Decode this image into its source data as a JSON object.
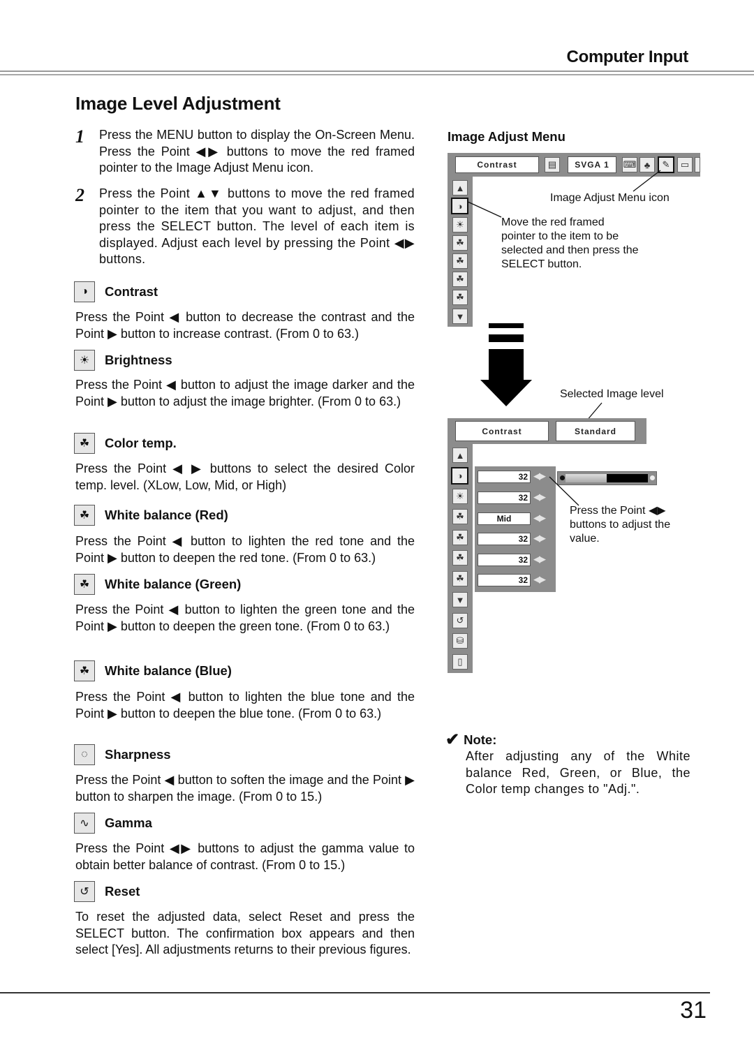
{
  "header": {
    "section_title": "Computer Input",
    "page_title": "Image Level Adjustment"
  },
  "steps": [
    {
      "number": "1",
      "text": "Press the MENU button to display the On-Screen Menu.  Press the Point ◀▶ buttons to move the red framed pointer to the Image Adjust Menu icon."
    },
    {
      "number": "2",
      "text": "Press the Point ▲▼ buttons to move the red framed pointer to the item that you want to adjust, and then press the SELECT button.  The level of each item is displayed.  Adjust each level by pressing the Point ◀▶ buttons."
    }
  ],
  "items": [
    {
      "icon": "contrast-icon",
      "glyph": "◑",
      "label": "Contrast",
      "desc": "Press the Point ◀ button to decrease the contrast and the Point ▶ button to increase contrast. (From 0 to 63.)"
    },
    {
      "icon": "brightness-icon",
      "glyph": "☀",
      "label": "Brightness",
      "desc": "Press the Point ◀ button to adjust the image darker and the Point ▶ button to adjust the image brighter. (From 0 to 63.)"
    },
    {
      "icon": "color-temp-icon",
      "glyph": "☘",
      "label": "Color temp.",
      "desc": "Press the Point ◀ ▶ buttons to select the desired Color temp. level. (XLow, Low, Mid, or High)"
    },
    {
      "icon": "white-balance-red-icon",
      "glyph": "☘",
      "label": "White balance (Red)",
      "desc": "Press the Point ◀ button to lighten the red tone and the Point ▶ button to deepen the red tone. (From 0 to 63.)"
    },
    {
      "icon": "white-balance-green-icon",
      "glyph": "☘",
      "label": "White balance (Green)",
      "desc": "Press the Point ◀ button to lighten the green tone and the Point ▶ button to deepen the green tone. (From 0 to 63.)"
    },
    {
      "icon": "white-balance-blue-icon",
      "glyph": "☘",
      "label": "White balance (Blue)",
      "desc": "Press the Point ◀ button to lighten the blue tone and the Point ▶ button to deepen the blue tone. (From 0 to 63.)"
    },
    {
      "icon": "sharpness-icon",
      "glyph": "◌",
      "label": "Sharpness",
      "desc": "Press the Point ◀ button to soften the image and the Point ▶ button to sharpen the image. (From 0 to 15.)"
    },
    {
      "icon": "gamma-icon",
      "glyph": "∿",
      "label": "Gamma",
      "desc": "Press the Point ◀▶ buttons to adjust the gamma value to obtain better balance of contrast. (From 0 to 15.)"
    },
    {
      "icon": "reset-icon",
      "glyph": "↺",
      "label": "Reset",
      "desc": "To reset the adjusted data, select Reset and press the SELECT button.  The confirmation box appears and then select [Yes].  All adjustments returns to their previous figures."
    }
  ],
  "image_adjust_menu": {
    "heading": "Image Adjust Menu",
    "top_menu": {
      "item_label": "Contrast",
      "source_label": "SVGA 1"
    },
    "callout_icon": "Image Adjust Menu icon",
    "callout_pointer": "Move the red framed pointer to the item to be selected and then press the SELECT button."
  },
  "selected_menu": {
    "callout_level": "Selected Image level",
    "item_label": "Contrast",
    "level_label": "Standard",
    "values": [
      "32",
      "32",
      "Mid",
      "32",
      "32",
      "32"
    ],
    "arrows": "◀▶",
    "contrast_slider_fraction": 0.5,
    "callout_adjust": "Press the Point ◀▶ buttons to adjust the value."
  },
  "note": {
    "check": "✔",
    "label": "Note:",
    "text": "After adjusting any of the White balance Red, Green, or Blue, the Color temp changes to \"Adj.\"."
  },
  "footer": {
    "page_number": "31"
  }
}
